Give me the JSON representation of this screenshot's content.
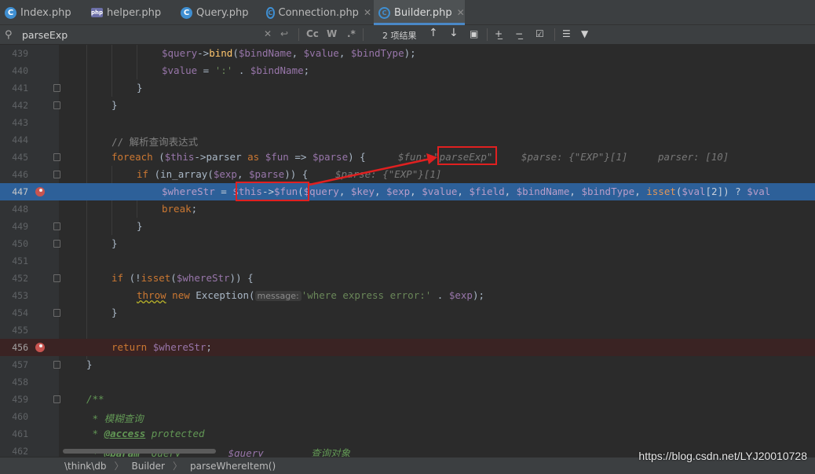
{
  "tabs": [
    {
      "label": "Index.php",
      "icon": "php-class-icon"
    },
    {
      "label": "helper.php",
      "icon": "php-file-icon"
    },
    {
      "label": "Query.php",
      "icon": "php-class-icon"
    },
    {
      "label": "Connection.php",
      "icon": "php-abstract-class-icon"
    },
    {
      "label": "Builder.php",
      "icon": "php-abstract-class-icon",
      "active": true
    }
  ],
  "search": {
    "query": "parseExp",
    "match_case": "Cc",
    "words": "W",
    "regex": ".*",
    "result_count": "2 项结果"
  },
  "code_lines": [
    {
      "num": "439"
    },
    {
      "num": "440"
    },
    {
      "num": "441"
    },
    {
      "num": "442"
    },
    {
      "num": "443"
    },
    {
      "num": "444"
    },
    {
      "num": "445"
    },
    {
      "num": "446"
    },
    {
      "num": "447"
    },
    {
      "num": "448"
    },
    {
      "num": "449"
    },
    {
      "num": "450"
    },
    {
      "num": "451"
    },
    {
      "num": "452"
    },
    {
      "num": "453"
    },
    {
      "num": "454"
    },
    {
      "num": "455"
    },
    {
      "num": "456"
    },
    {
      "num": "457"
    },
    {
      "num": "458"
    },
    {
      "num": "459"
    },
    {
      "num": "460"
    },
    {
      "num": "461"
    },
    {
      "num": "462"
    }
  ],
  "code": {
    "l439_a": "$query",
    "l439_b": "->",
    "l439_c": "bind",
    "l439_d": "(",
    "l439_e": "$bindName",
    "l439_f": ", ",
    "l439_g": "$value",
    "l439_h": ", ",
    "l439_i": "$bindType",
    "l439_j": ");",
    "l440_a": "$value",
    "l440_b": " = ",
    "l440_c": "':'",
    "l440_d": " . ",
    "l440_e": "$bindName",
    "l440_f": ";",
    "l441": "}",
    "l442": "}",
    "l444": "// 解析查询表达式",
    "l445_a": "foreach",
    "l445_b": " (",
    "l445_c": "$this",
    "l445_d": "->parser ",
    "l445_e": "as",
    "l445_f": " ",
    "l445_g": "$fun",
    "l445_h": " => ",
    "l445_i": "$parse",
    "l445_j": ") {",
    "l445_hint1": "$fun: ",
    "l445_hint2": "\"parseExp\"",
    "l445_hint3": "$parse: {\"EXP\"}[1]",
    "l445_hint4": "parser: [10]",
    "l446_a": "if",
    "l446_b": " (in_array(",
    "l446_c": "$exp",
    "l446_d": ", ",
    "l446_e": "$parse",
    "l446_f": ")) {",
    "l446_hint": "$parse: {\"EXP\"}[1]",
    "l447_a": "$whereStr",
    "l447_b": " = ",
    "l447_c": "$this",
    "l447_d": "->",
    "l447_e": "$fun",
    "l447_f": "(",
    "l447_g": "$query",
    "l447_h": ", ",
    "l447_i": "$key",
    "l447_j": ", ",
    "l447_k": "$exp",
    "l447_l": ", ",
    "l447_m": "$value",
    "l447_n": ", ",
    "l447_o": "$field",
    "l447_p": ", ",
    "l447_q": "$bindName",
    "l447_r": ", ",
    "l447_s": "$bindType",
    "l447_t": ", ",
    "l447_u": "isset",
    "l447_v": "(",
    "l447_w": "$val",
    "l447_x": "[2]) ? ",
    "l447_y": "$val",
    "l448_a": "break",
    "l448_b": ";",
    "l449": "}",
    "l450": "}",
    "l452_a": "if",
    "l452_b": " (!",
    "l452_c": "isset",
    "l452_d": "(",
    "l452_e": "$whereStr",
    "l452_f": ")) {",
    "l453_a": "throw",
    "l453_b": " ",
    "l453_c": "new",
    "l453_d": " Exception(",
    "l453_hint": "message:",
    "l453_e": "'where express error:'",
    "l453_f": " . ",
    "l453_g": "$exp",
    "l453_h": ");",
    "l454": "}",
    "l456_a": "return",
    "l456_b": " ",
    "l456_c": "$whereStr",
    "l456_d": ";",
    "l457": "}",
    "l459": "/**",
    "l460": " * 模糊查询",
    "l461_a": " * ",
    "l461_b": "@access",
    "l461_c": " protected",
    "l462_a": " * ",
    "l462_b": "@param",
    "l462_c": "  Query        ",
    "l462_d": "$query",
    "l462_e": "        查询对象"
  },
  "breadcrumb": {
    "items": [
      "\\think\\db",
      "Builder",
      "parseWhereItem()"
    ]
  },
  "watermark": "https://blog.csdn.net/LYJ20010728",
  "colors": {
    "highlight_line": "#2d6099",
    "breakpoint": "#c75450",
    "annotation": "#e02020"
  }
}
